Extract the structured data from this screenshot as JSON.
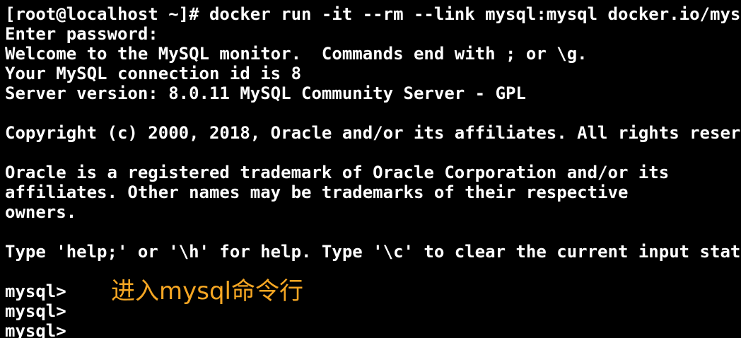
{
  "terminal": {
    "lines": [
      "[root@localhost ~]# docker run -it --rm --link mysql:mysql docker.io/mysql",
      "Enter password:",
      "Welcome to the MySQL monitor.  Commands end with ; or \\g.",
      "Your MySQL connection id is 8",
      "Server version: 8.0.11 MySQL Community Server - GPL",
      "",
      "Copyright (c) 2000, 2018, Oracle and/or its affiliates. All rights reserved.",
      "",
      "Oracle is a registered trademark of Oracle Corporation and/or its",
      "affiliates. Other names may be trademarks of their respective",
      "owners.",
      "",
      "Type 'help;' or '\\h' for help. Type '\\c' to clear the current input statement.",
      "",
      "mysql>",
      "mysql>",
      "mysql>"
    ],
    "annotation": "进入mysql命令行",
    "text_color": "#ffffff",
    "annotation_color": "#f5a623",
    "background": "#000000"
  }
}
